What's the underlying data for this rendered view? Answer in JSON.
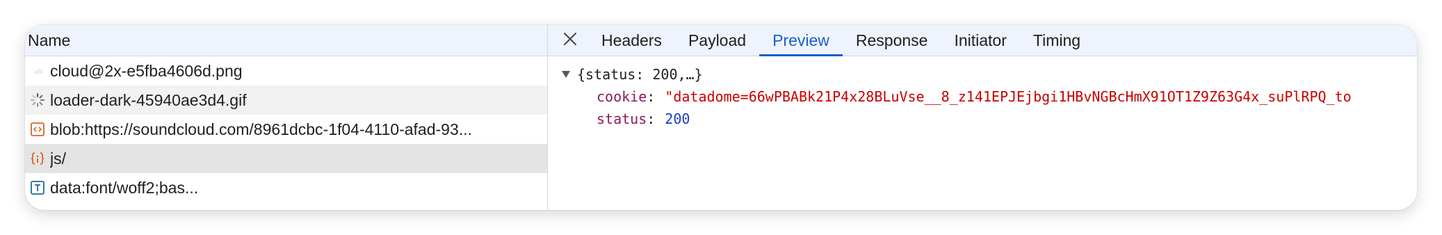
{
  "network": {
    "column_name": "Name",
    "requests": [
      {
        "label": "cloud@2x-e5fba4606d.png",
        "icon": "image-icon"
      },
      {
        "label": "loader-dark-45940ae3d4.gif",
        "icon": "spinner-icon"
      },
      {
        "label": "blob:https://soundcloud.com/8961dcbc-1f04-4110-afad-93...",
        "icon": "code-icon"
      },
      {
        "label": "js/",
        "icon": "json-icon"
      },
      {
        "label": "data:font/woff2;bas...",
        "icon": "font-icon"
      }
    ]
  },
  "details": {
    "tabs": [
      "Headers",
      "Payload",
      "Preview",
      "Response",
      "Initiator",
      "Timing"
    ],
    "active_tab": "Preview",
    "preview": {
      "root": "{status: 200,…}",
      "props": [
        {
          "key": "cookie",
          "value": "\"datadome=66wPBABk21P4x28BLuVse__8_z141EPJEjbgi1HBvNGBcHmX91OT1Z9Z63G4x_suPlRPQ_to"
        },
        {
          "key": "status",
          "value": "200"
        }
      ]
    }
  },
  "colors": {
    "accent": "#1a5fc7",
    "key": "#8b1a5c",
    "string": "#c80000",
    "number": "#1b3ccc",
    "header_bg": "#eef3fd"
  }
}
